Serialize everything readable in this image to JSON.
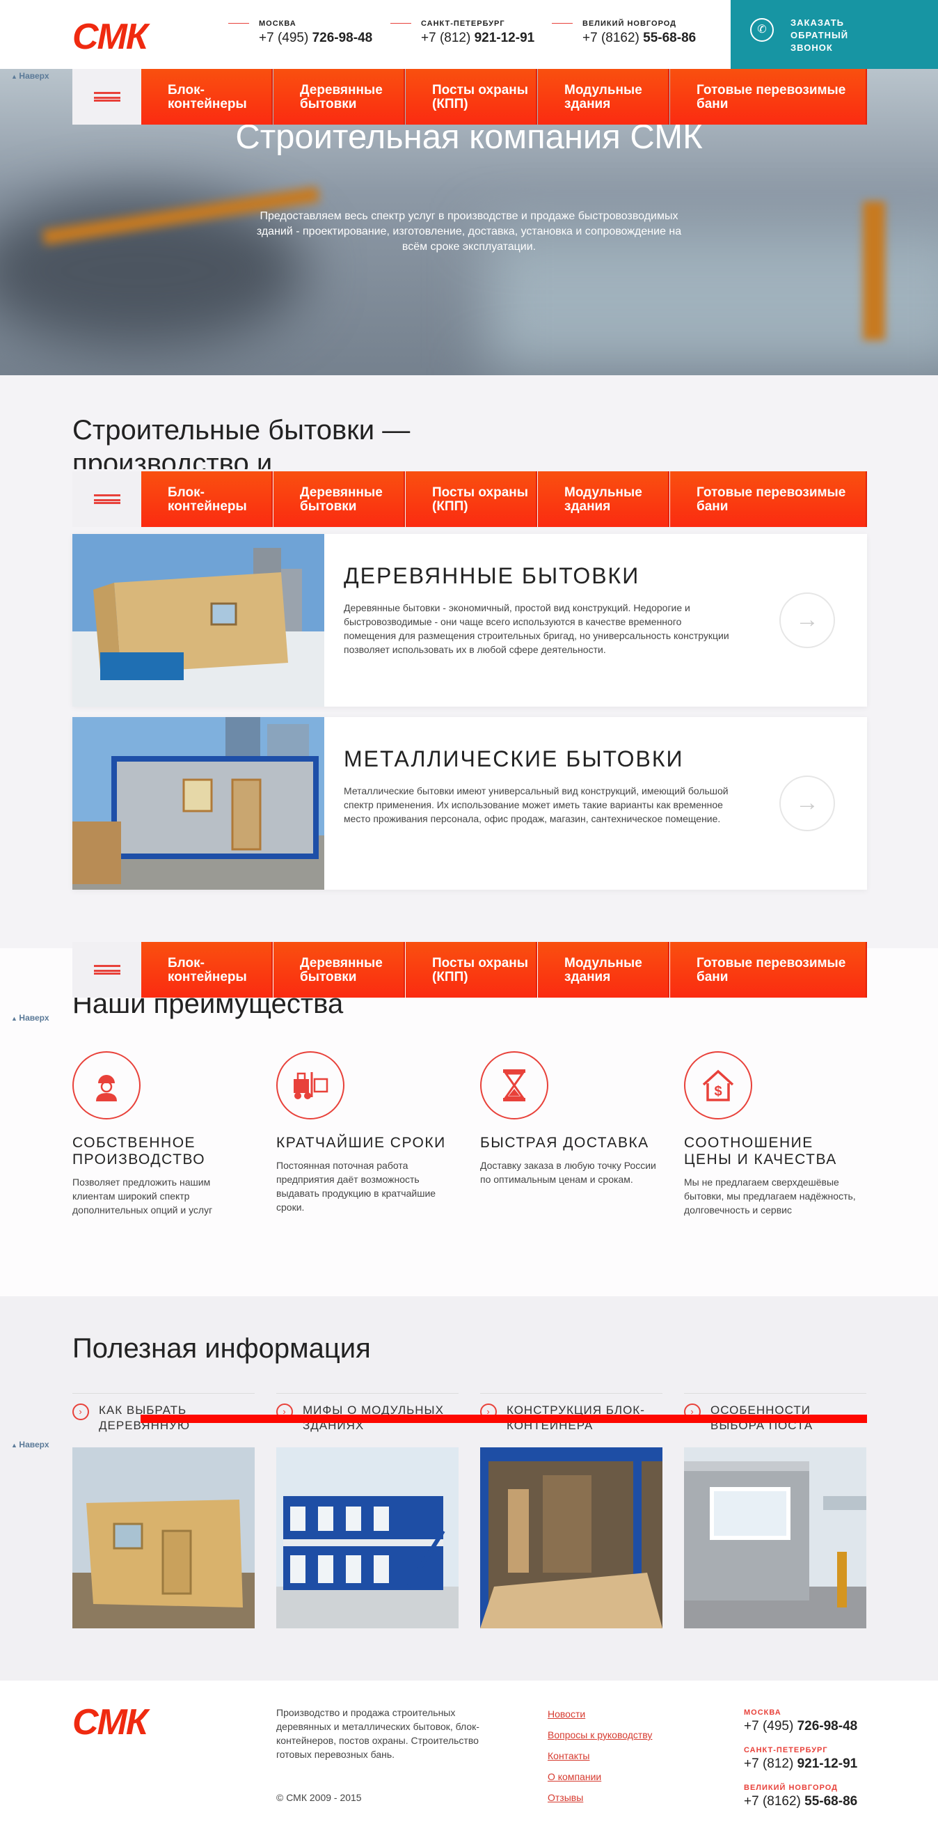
{
  "header": {
    "logo": "СМК",
    "contacts": [
      {
        "city": "МОСКВА",
        "code": "+7 (495)",
        "number": "726-98-48"
      },
      {
        "city": "САНКТ-ПЕТЕРБУРГ",
        "code": "+7 (812)",
        "number": "921-12-91"
      },
      {
        "city": "ВЕЛИКИЙ НОВГОРОД",
        "code": "+7 (8162)",
        "number": "55-68-86"
      }
    ],
    "callback": "ЗАКАЗАТЬ ОБРАТНЫЙ ЗВОНОК"
  },
  "nav": {
    "items": [
      "Блок-контейнеры",
      "Деревянные бытовки",
      "Посты охраны (КПП)",
      "Модульные здания",
      "Готовые перевозимые бани"
    ]
  },
  "up_label": "Наверх",
  "hero": {
    "title": "Строительная компания СМК",
    "subtitle": "Предоставляем весь спектр услуг в производстве и продаже быстровозводимых зданий - проектирование, изготовление, доставка, установка и сопровождение на всём сроке эксплуатации."
  },
  "section1": {
    "title": "Строительные бытовки — производство и",
    "cards": [
      {
        "title": "ДЕРЕВЯННЫЕ БЫТОВКИ",
        "text": "Деревянные бытовки - экономичный, простой вид конструкций. Недорогие и быстровозводимые - они чаще всего используются в качестве временного помещения для размещения строительных бригад, но универсальность конструкции позволяет использовать их в любой сфере деятельности."
      },
      {
        "title": "МЕТАЛЛИЧЕСКИЕ БЫТОВКИ",
        "text": "Металлические бытовки имеют универсальный вид конструкций, имеющий большой спектр применения. Их использование может иметь такие варианты как временное место проживания персонала, офис продаж, магазин, сантехническое помещение."
      }
    ]
  },
  "advantages": {
    "title": "Наши преимущества",
    "items": [
      {
        "title": "СОБСТВЕННОЕ ПРОИЗВОДСТВО",
        "text": "Позволяет предложить нашим клиентам широкий спектр дополнительных опций и услуг",
        "icon": "worker-icon"
      },
      {
        "title": "КРАТЧАЙШИЕ СРОКИ",
        "text": "Постоянная поточная работа предприятия даёт возможность выдавать продукцию в кратчайшие сроки.",
        "icon": "forklift-icon"
      },
      {
        "title": "БЫСТРАЯ ДОСТАВКА",
        "text": "Доставку заказа в любую точку России по оптимальным ценам и срокам.",
        "icon": "hourglass-icon"
      },
      {
        "title": "СООТНОШЕНИЕ ЦЕНЫ И КАЧЕСТВА",
        "text": "Мы не предлагаем сверхдешёвые бытовки, мы предлагаем надёжность, долговечность и сервис",
        "icon": "house-dollar-icon"
      }
    ]
  },
  "info": {
    "title": "Полезная информация",
    "items": [
      {
        "title": "КАК ВЫБРАТЬ ДЕРЕВЯННУЮ БЫТОВКУ"
      },
      {
        "title": "МИФЫ О МОДУЛЬНЫХ ЗДАНИЯХ"
      },
      {
        "title": "КОНСТРУКЦИЯ БЛОК-КОНТЕЙНЕРА"
      },
      {
        "title": "ОСОБЕННОСТИ ВЫБОРА ПОСТА ОХРАНЫ"
      }
    ]
  },
  "footer": {
    "logo": "СМК",
    "description": "Производство и продажа строительных деревянных и металлических бытовок, блок-контейнеров, постов охраны. Строительство готовых перевозных бань.",
    "copyright": "© СМК 2009 - 2015",
    "links": [
      "Новости",
      "Вопросы к руководству",
      "Контакты",
      "О компании",
      "Отзывы"
    ],
    "contacts": [
      {
        "city": "МОСКВА",
        "code": "+7 (495)",
        "number": "726-98-48"
      },
      {
        "city": "САНКТ-ПЕТЕРБУРГ",
        "code": "+7 (812)",
        "number": "921-12-91"
      },
      {
        "city": "ВЕЛИКИЙ НОВГОРОД",
        "code": "+7 (8162)",
        "number": "55-68-86"
      }
    ]
  },
  "colors": {
    "accent": "#f4401a",
    "teal": "#1795a3",
    "text": "#222222"
  }
}
